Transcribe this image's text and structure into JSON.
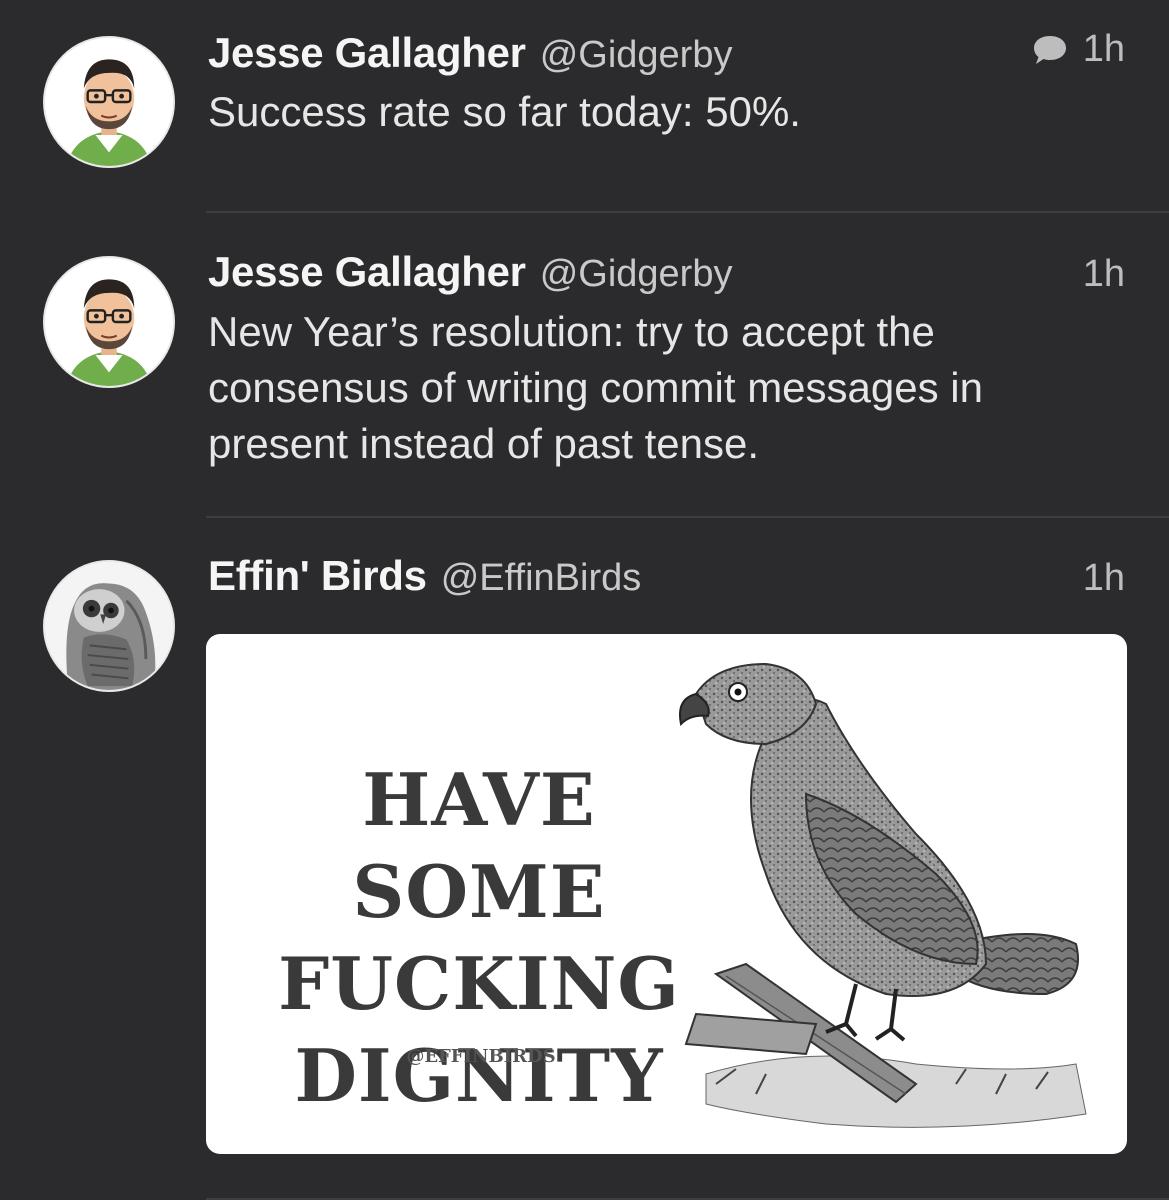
{
  "tweets": [
    {
      "name": "Jesse Gallagher",
      "handle": "@Gidgerby",
      "time": "1h",
      "text": "Success rate so far today: 50%.",
      "icon": "reply-bubble-icon"
    },
    {
      "name": "Jesse Gallagher",
      "handle": "@Gidgerby",
      "time": "1h",
      "text": "New Year’s resolution: try to accept the consensus of writing commit messages in present instead of past tense."
    },
    {
      "name": "Effin' Birds",
      "handle": "@EffinBirds",
      "time": "1h",
      "media": {
        "lines": [
          "HAVE SOME",
          "FUCKING",
          "DIGNITY"
        ],
        "watermark": "@EFFINBIRDS"
      }
    }
  ],
  "colors": {
    "background": "#2b2b2d",
    "divider": "#3e3e41",
    "name": "#f5f5f5",
    "secondary": "#bdbdbd"
  }
}
